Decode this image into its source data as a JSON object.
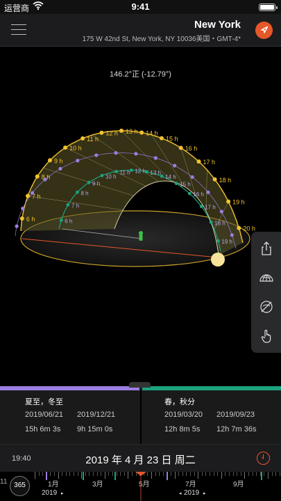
{
  "status": {
    "carrier": "运营商",
    "time": "9:41"
  },
  "header": {
    "city": "New York",
    "address": "175 W 42nd St, New York, NY 10036美国・GMT-4*"
  },
  "scene": {
    "azimuth": "146.2°正 (-12.79°)",
    "hour_labels_upper": [
      "6 h",
      "7 h",
      "8 h",
      "9 h",
      "10 h",
      "11 h",
      "12 h",
      "13 h",
      "14 h",
      "15 h",
      "16 h",
      "17 h",
      "18 h",
      "19 h",
      "20 h"
    ],
    "hour_labels_lower": [
      "6 h",
      "7 h",
      "8 h",
      "9 h",
      "10 h",
      "11 h",
      "12 h",
      "13 h",
      "14 h",
      "15 h",
      "16 h",
      "17 h",
      "18 h",
      "19 h"
    ],
    "help_label": "?"
  },
  "panel": {
    "solstice": {
      "title": "夏至，冬至",
      "date1": "2019/06/21",
      "date2": "2019/12/21",
      "len1": "15h 6m 3s",
      "len2": "9h 15m 0s"
    },
    "equinox": {
      "title": "春，秋分",
      "date1": "2019/03/20",
      "date2": "2019/09/23",
      "len1": "12h 8m 5s",
      "len2": "12h 7m 36s"
    }
  },
  "timebar": {
    "time": "19:40",
    "date": "2019 年 4 月 23 日 周二"
  },
  "ruler": {
    "badge": "365",
    "months": [
      "1月",
      "3月",
      "5月",
      "7月",
      "9月"
    ],
    "year_left": "2019",
    "year_right": "2019",
    "day_label": "11"
  },
  "colors": {
    "accent": "#e5582a",
    "solstice": "#9b7fe0",
    "equinox": "#1ba37d",
    "summer_path": "#f2c230"
  }
}
